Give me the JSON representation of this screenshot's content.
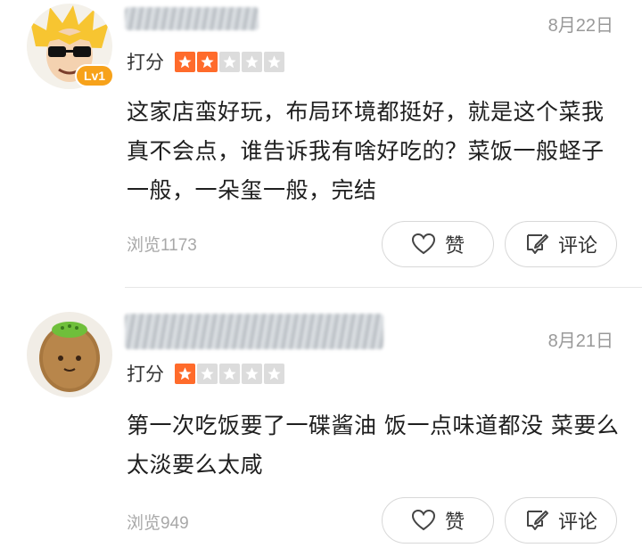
{
  "reviews": [
    {
      "username": "",
      "level_badge": "Lv1",
      "date": "8月22日",
      "rating_label": "打分",
      "stars_filled": 2,
      "stars_total": 5,
      "content": "这家店蛮好玩，布局环境都挺好，就是这个菜我真不会点，谁告诉我有啥好吃的？菜饭一般蛏子一般，一朵玺一般，完结",
      "views": "浏览1173",
      "like_label": "赞",
      "comment_label": "评论"
    },
    {
      "username": "",
      "date": "8月21日",
      "rating_label": "打分",
      "stars_filled": 1,
      "stars_total": 5,
      "content": "第一次吃饭要了一碟酱油 饭一点味道都没 菜要么太淡要么太咸",
      "views": "浏览949",
      "like_label": "赞",
      "comment_label": "评论"
    }
  ],
  "colors": {
    "star_on": "#ff6b2b",
    "star_off": "#dcdcdc",
    "badge": "#f7a21a",
    "muted_text": "#999999"
  },
  "icons": [
    "heart-icon",
    "comment-edit-icon",
    "star-icon"
  ]
}
